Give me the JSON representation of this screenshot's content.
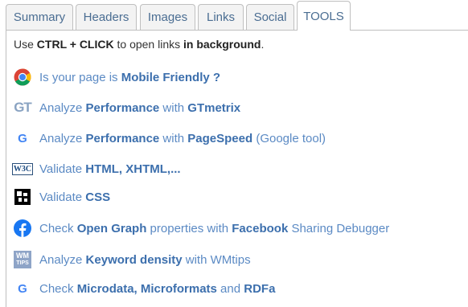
{
  "tabs": [
    {
      "label": "Summary",
      "active": false
    },
    {
      "label": "Headers",
      "active": false
    },
    {
      "label": "Images",
      "active": false
    },
    {
      "label": "Links",
      "active": false
    },
    {
      "label": "Social",
      "active": false
    },
    {
      "label": "TOOLS",
      "active": true
    }
  ],
  "note": {
    "pre": "Use ",
    "keys": "CTRL + CLICK",
    "mid": " to open links ",
    "strong": "in background",
    "end": "."
  },
  "tools": [
    {
      "icon": "chrome-icon",
      "parts": [
        {
          "t": "Is your page is "
        },
        {
          "t": "Mobile Friendly ?",
          "b": true
        }
      ]
    },
    {
      "icon": "gtmetrix-icon",
      "parts": [
        {
          "t": "Analyze "
        },
        {
          "t": "Performance",
          "b": true
        },
        {
          "t": " with "
        },
        {
          "t": "GTmetrix",
          "b": true
        }
      ]
    },
    {
      "icon": "google-icon",
      "parts": [
        {
          "t": "Analyze "
        },
        {
          "t": "Performance",
          "b": true
        },
        {
          "t": " with "
        },
        {
          "t": "PageSpeed",
          "b": true
        },
        {
          "t": " (Google tool)"
        }
      ]
    },
    {
      "icon": "w3c-icon",
      "parts": [
        {
          "t": "Validate "
        },
        {
          "t": "HTML, XHTML,...",
          "b": true
        }
      ]
    },
    {
      "icon": "css-icon",
      "parts": [
        {
          "t": "Validate "
        },
        {
          "t": "CSS",
          "b": true
        }
      ]
    },
    {
      "icon": "facebook-icon",
      "parts": [
        {
          "t": "Check "
        },
        {
          "t": "Open Graph",
          "b": true
        },
        {
          "t": " properties with "
        },
        {
          "t": "Facebook",
          "b": true
        },
        {
          "t": " Sharing Debugger"
        }
      ]
    },
    {
      "icon": "wmtips-icon",
      "parts": [
        {
          "t": "Analyze "
        },
        {
          "t": "Keyword density",
          "b": true
        },
        {
          "t": " with WMtips"
        }
      ]
    },
    {
      "icon": "google-icon",
      "parts": [
        {
          "t": "Check "
        },
        {
          "t": "Microdata, Microformats",
          "b": true
        },
        {
          "t": " and "
        },
        {
          "t": "RDFa",
          "b": true
        }
      ]
    }
  ],
  "icons": {
    "gtmetrix_text": "GT",
    "w3c_text": "W3C",
    "wmtips_line1": "WM",
    "wmtips_line2": "TIPS"
  },
  "colors": {
    "link": "#5b8ac4",
    "link_bold": "#3c6fad",
    "tab_text": "#4a6d92",
    "border": "#bfbfbf"
  }
}
